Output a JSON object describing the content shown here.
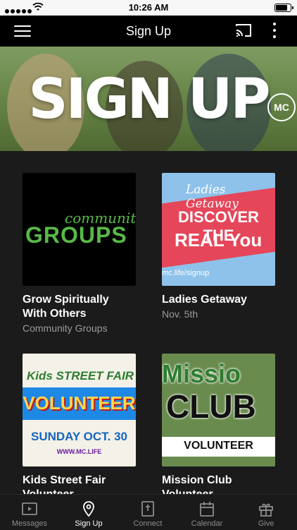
{
  "status_bar": {
    "time": "10:26 AM",
    "battery_level": 0.9
  },
  "header": {
    "title": "Sign Up",
    "menu_icon": "hamburger-menu-icon",
    "cast_icon": "cast-icon",
    "more_icon": "more-vertical-icon"
  },
  "hero": {
    "title": "SIGN UP",
    "logo_text": "MC"
  },
  "cards": [
    {
      "title": "Grow Spiritually With Others",
      "subtitle": "Community Groups",
      "image_text": {
        "small": "community",
        "big": "GROUPS"
      }
    },
    {
      "title": "Ladies Getaway",
      "subtitle": "Nov. 5th",
      "image_text": {
        "script": "Ladies Getaway",
        "line1": "DISCOVER THE",
        "line2": "REAL You",
        "url": "mc.life/signup"
      }
    },
    {
      "title": "Kids Street Fair Volunteer",
      "subtitle": "",
      "image_text": {
        "line1": "Kids STREET FAIR",
        "line2": "VOLUNTEER",
        "line3": "SUNDAY OCT. 30",
        "url": "WWW.MC.LIFE"
      }
    },
    {
      "title": "Mission Club Volunteer",
      "subtitle": "",
      "image_text": {
        "line1": "Missio",
        "line2": "CLUB",
        "line3": "VOLUNTEER"
      }
    }
  ],
  "tabs": [
    {
      "label": "Messages",
      "icon": "video-icon",
      "active": false
    },
    {
      "label": "Sign Up",
      "icon": "location-pin-icon",
      "active": true
    },
    {
      "label": "Connect",
      "icon": "bible-icon",
      "active": false
    },
    {
      "label": "Calendar",
      "icon": "calendar-icon",
      "active": false
    },
    {
      "label": "Give",
      "icon": "gift-icon",
      "active": false
    }
  ],
  "colors": {
    "background": "#1b1b1b",
    "navbar": "#000000",
    "tab_active": "#ffffff",
    "tab_inactive": "#8c8c8c",
    "subtitle": "#9a9a9a"
  }
}
